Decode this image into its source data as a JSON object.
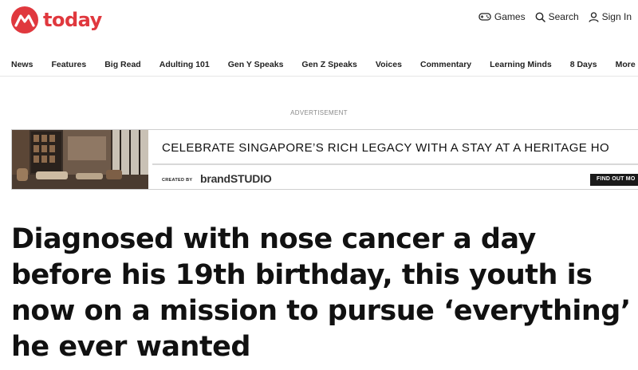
{
  "brand": {
    "name": "today",
    "logo_icon": "mediacorp-m-icon",
    "accent": "#e0383e"
  },
  "utilities": [
    {
      "label": "Games",
      "icon": "gamepad-icon"
    },
    {
      "label": "Search",
      "icon": "search-icon"
    },
    {
      "label": "Sign In",
      "icon": "user-icon"
    }
  ],
  "nav": {
    "items": [
      "News",
      "Features",
      "Big Read",
      "Adulting 101",
      "Gen Y Speaks",
      "Gen Z Speaks",
      "Voices",
      "Commentary",
      "Learning Minds",
      "8 Days"
    ],
    "more_label": "More",
    "more_icon": "chevron-down-icon",
    "more_color": "#e0383e"
  },
  "advertisement": {
    "label": "ADVERTISEMENT",
    "headline": "CELEBRATE SINGAPORE’S RICH LEGACY WITH A STAY AT A HERITAGE HO",
    "created_by": "CREATED BY",
    "brand": "brandSTUDIO",
    "cta": "FIND OUT MO"
  },
  "article": {
    "title": "Diagnosed with nose cancer a day before his 19th birthday, this youth is now on a mission to pursue ‘everything’ he ever wanted"
  }
}
